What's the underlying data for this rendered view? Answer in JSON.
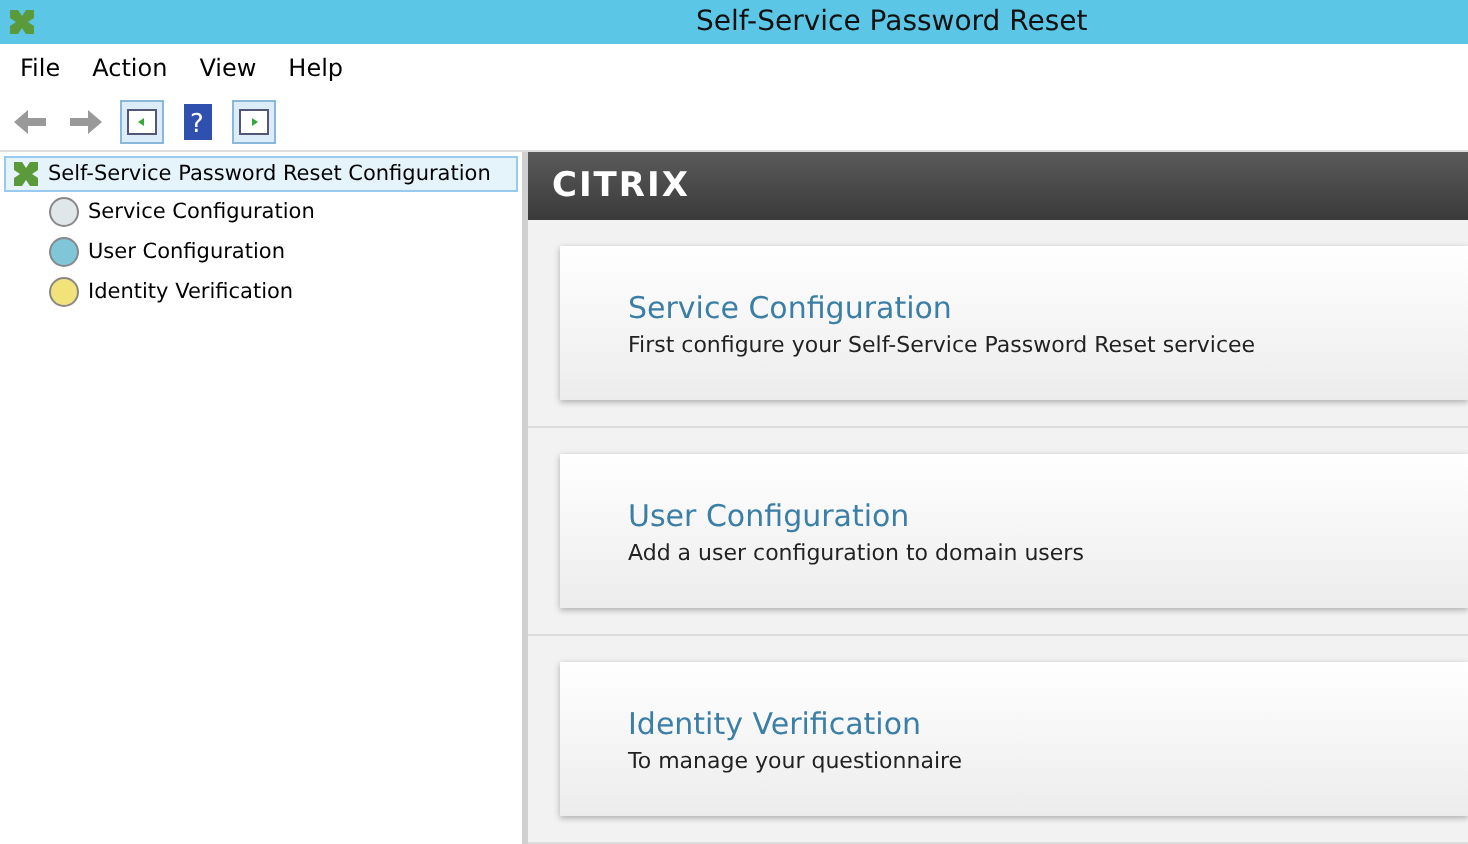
{
  "window": {
    "title": "Self-Service Password Reset"
  },
  "menu": [
    "File",
    "Action",
    "View",
    "Help"
  ],
  "toolbar": {
    "help": "?"
  },
  "tree": {
    "label": "Self-Service Password Reset Configuration",
    "selected": true,
    "children": [
      {
        "label": "Service Configuration",
        "selected": false
      },
      {
        "label": "User Configuration",
        "selected": false
      },
      {
        "label": "Identity Verification",
        "selected": false
      }
    ]
  },
  "header": {
    "logo": "CITRIX"
  },
  "cards": [
    {
      "title": "Service Configuration",
      "description": "First configure your Self-Service Password Reset servicee"
    },
    {
      "title": "User Configuration",
      "description": "Add a user configuration to domain users"
    },
    {
      "title": "Identity Verification",
      "description": "To manage your questionnaire"
    }
  ]
}
